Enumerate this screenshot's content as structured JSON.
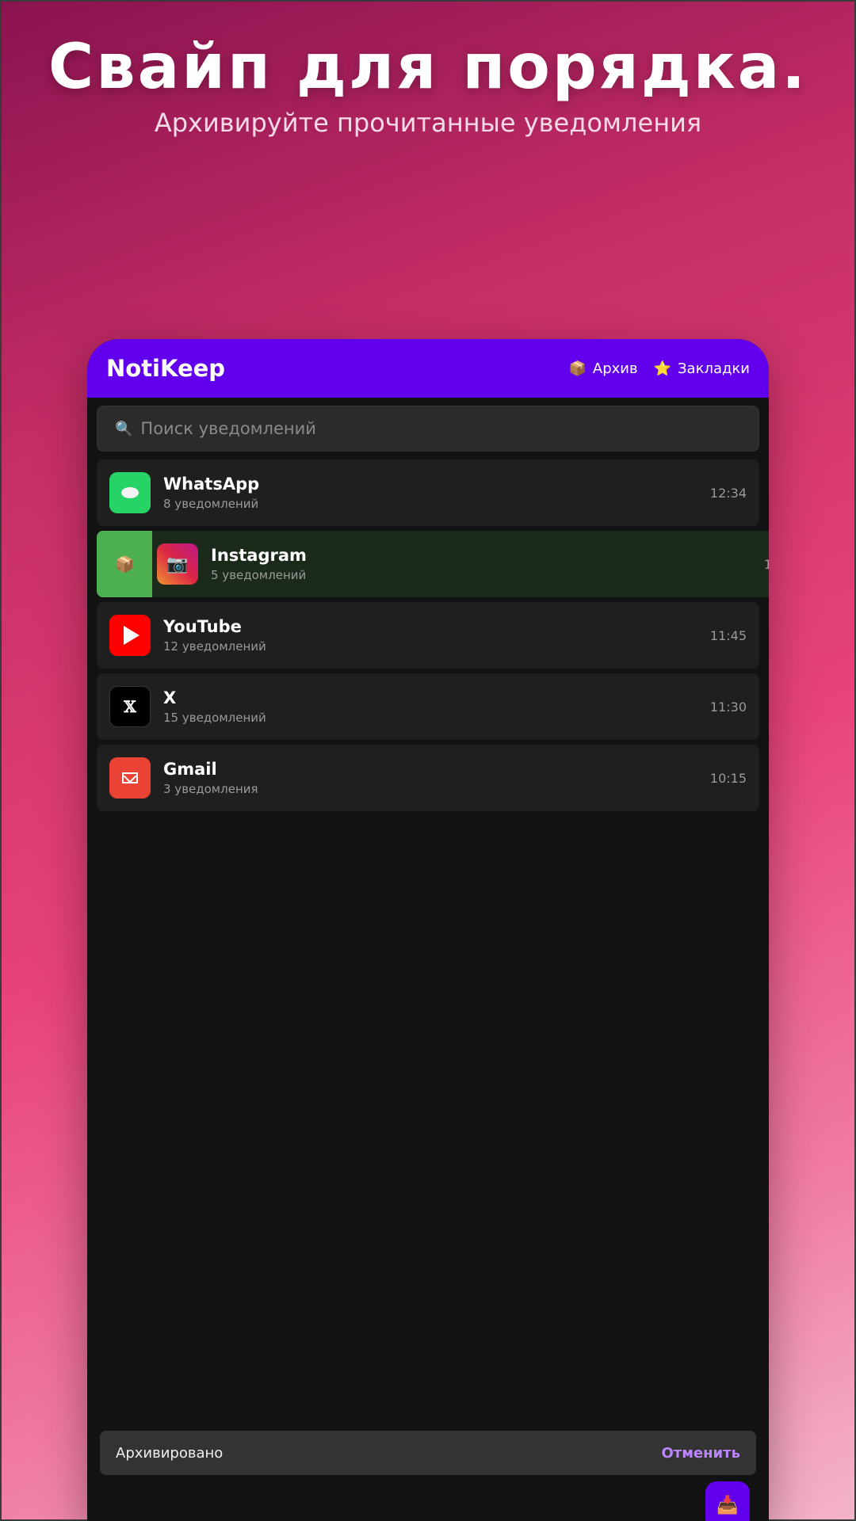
{
  "hero": {
    "title": "Свайп для порядка.",
    "subtitle": "Архивируйте прочитанные уведомления"
  },
  "app_bar": {
    "title": "NotiKeep",
    "archive_label": "Архив",
    "bookmarks_label": "Закладки",
    "archive_icon": "📦",
    "bookmarks_icon": "⭐"
  },
  "search": {
    "icon": "🔍",
    "placeholder": "Поиск уведомлений",
    "value": ""
  },
  "notifications": [
    {
      "app": "WhatsApp",
      "count_text": "8 уведомлений",
      "time": "12:34",
      "color": "#25d366"
    },
    {
      "app": "Instagram",
      "count_text": "5 уведомлений",
      "time": "1",
      "color": "#dc2743",
      "swiped": true,
      "swipe_icon": "📦",
      "icon": "📷"
    },
    {
      "app": "YouTube",
      "count_text": "12 уведомлений",
      "time": "11:45",
      "color": "#ff0000"
    },
    {
      "app": "X",
      "count_text": "15 уведомлений",
      "time": "11:30",
      "color": "#000000",
      "icon": "𝕏"
    },
    {
      "app": "Gmail",
      "count_text": "3 уведомления",
      "time": "10:15",
      "color": "#ea4335"
    }
  ],
  "snackbar": {
    "text": "Архивировано",
    "action": "Отменить"
  },
  "fab": {
    "icon": "📥"
  },
  "colors": {
    "primary": "#6200ee",
    "accent": "#bb86fc",
    "swipe_archive": "#4caf50"
  }
}
